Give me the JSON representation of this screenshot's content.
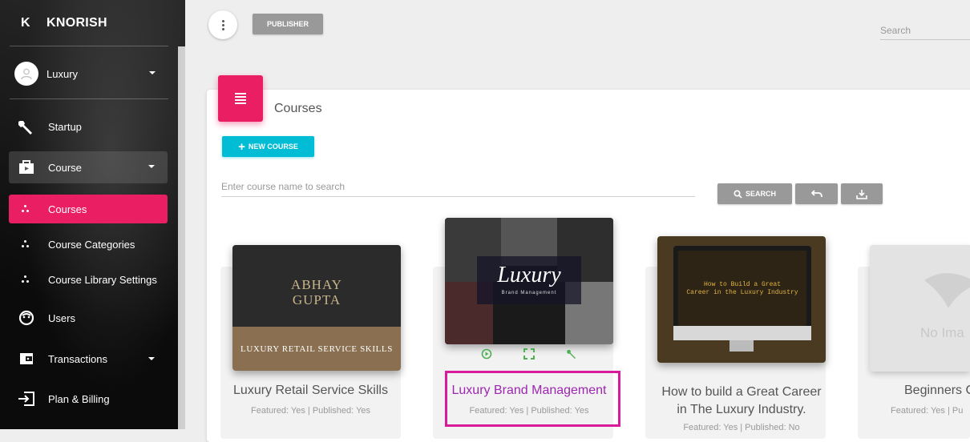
{
  "brand": {
    "initial": "K",
    "name": "KNORISH"
  },
  "user": {
    "name": "Luxury"
  },
  "sidebar": {
    "items": [
      {
        "label": "Startup"
      },
      {
        "label": "Course"
      },
      {
        "label": "Courses"
      },
      {
        "label": "Course Categories"
      },
      {
        "label": "Course Library Settings"
      },
      {
        "label": "Users"
      },
      {
        "label": "Transactions"
      },
      {
        "label": "Plan & Billing"
      }
    ]
  },
  "topbar": {
    "publisher_label": "PUBLISHER",
    "search_placeholder": "Search"
  },
  "page": {
    "title": "Courses",
    "new_course_label": "NEW COURSE",
    "search_placeholder": "Enter course name to search",
    "search_button_label": "SEARCH"
  },
  "courses": [
    {
      "title": "Luxury Retail Service Skills",
      "meta": "Featured: Yes | Published: Yes",
      "thumb_line1": "ABHAY",
      "thumb_line2": "GUPTA",
      "thumb_caption": "LUXURY RETAIL SERVICE SKILLS"
    },
    {
      "title": "Luxury Brand Management",
      "meta": "Featured: Yes | Published: Yes",
      "thumb_script": "Luxury",
      "thumb_sub": "Brand Management"
    },
    {
      "title_line1": "How to build a Great Career",
      "title_line2": "in The Luxury Industry.",
      "meta": "Featured: Yes | Published: No",
      "thumb_line1": "How to Build a Great",
      "thumb_line2": "Career in the Luxury Industry"
    },
    {
      "title": "Beginners C",
      "meta": "Featured: Yes | Pu",
      "thumb_text": "No Ima"
    }
  ],
  "colors": {
    "accent": "#e91e63",
    "cyan": "#00bcd4",
    "highlight": "#d81b9b",
    "link": "#9c27b0"
  }
}
